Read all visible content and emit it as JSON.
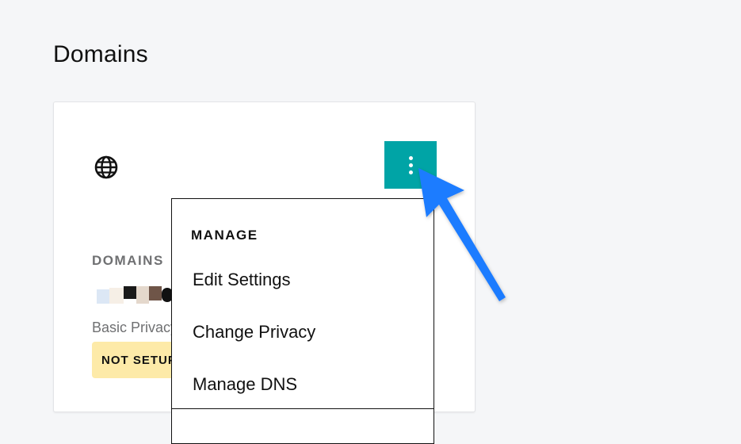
{
  "page": {
    "title": "Domains"
  },
  "card": {
    "icon": "globe-icon",
    "section_label": "DOMAINS",
    "domain_name": "",
    "privacy_text": "Basic Privacy",
    "status_badge": "NOT SETUP",
    "kebab_icon": "more-vertical-icon",
    "kebab_color": "#00a4a6",
    "badge_color": "#fdeaa8"
  },
  "menu": {
    "header": "MANAGE",
    "items": [
      {
        "label": "Edit Settings"
      },
      {
        "label": "Change Privacy"
      },
      {
        "label": "Manage DNS"
      }
    ]
  },
  "annotation": {
    "icon": "pointer-arrow-icon",
    "color": "#1f7bff"
  }
}
